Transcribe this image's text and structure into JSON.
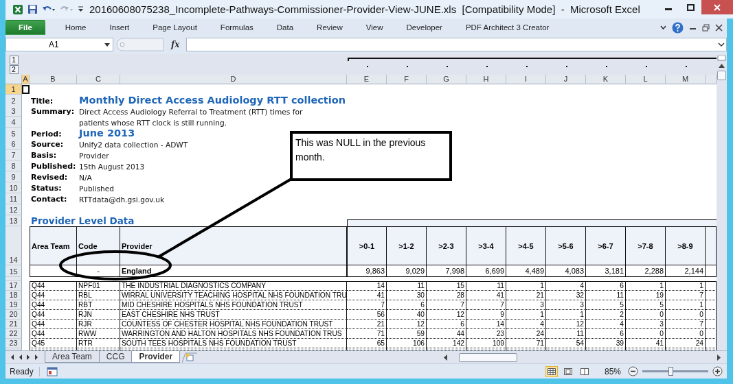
{
  "window": {
    "title": "20160608075238_Incomplete-Pathways-Commissioner-Provider-View-JUNE.xls  [Compatibility Mode]  -  Microsoft Excel"
  },
  "ribbon_tabs": [
    {
      "label": "File",
      "kind": "file",
      "selected": false
    },
    {
      "label": "Home",
      "kind": "tab",
      "selected": false
    },
    {
      "label": "Insert",
      "kind": "tab",
      "selected": false
    },
    {
      "label": "Page Layout",
      "kind": "tab",
      "selected": false
    },
    {
      "label": "Formulas",
      "kind": "tab",
      "selected": false
    },
    {
      "label": "Data",
      "kind": "tab",
      "selected": false
    },
    {
      "label": "Review",
      "kind": "tab",
      "selected": false
    },
    {
      "label": "View",
      "kind": "tab",
      "selected": false
    },
    {
      "label": "Developer",
      "kind": "tab",
      "selected": false
    },
    {
      "label": "PDF Architect 3 Creator",
      "kind": "tab",
      "selected": false
    }
  ],
  "formula_bar": {
    "name_box": "A1",
    "function_label": "fx"
  },
  "outline_levels": [
    "1",
    "2"
  ],
  "columns": [
    {
      "label": "A",
      "selected": true
    },
    {
      "label": "B",
      "selected": false
    },
    {
      "label": "C",
      "selected": false
    },
    {
      "label": "D",
      "selected": false
    },
    {
      "label": "E",
      "selected": false
    },
    {
      "label": "F",
      "selected": false
    },
    {
      "label": "G",
      "selected": false
    },
    {
      "label": "H",
      "selected": false
    },
    {
      "label": "I",
      "selected": false
    },
    {
      "label": "J",
      "selected": false
    },
    {
      "label": "K",
      "selected": false
    },
    {
      "label": "L",
      "selected": false
    },
    {
      "label": "M",
      "selected": false
    }
  ],
  "rows": [
    {
      "number": "1",
      "kind": "blank",
      "selected": true
    },
    {
      "number": "2",
      "kind": "info",
      "label": "Title:",
      "value": "Monthly Direct Access Audiology RTT collection",
      "emphasis": true,
      "selected": false
    },
    {
      "number": "3",
      "kind": "info",
      "label": "Summary:",
      "value": "Direct Access Audiology Referral to Treatment (RTT) times for",
      "emphasis": false,
      "selected": false
    },
    {
      "number": "4",
      "kind": "info",
      "value": "patients whose RTT clock is still running.",
      "emphasis": false,
      "selected": false
    },
    {
      "number": "5",
      "kind": "info",
      "label": "Period:",
      "value": "June 2013",
      "emphasis": true,
      "selected": false
    },
    {
      "number": "6",
      "kind": "info",
      "label": "Source:",
      "value": "Unify2 data collection - ADWT",
      "emphasis": false,
      "selected": false
    },
    {
      "number": "7",
      "kind": "info",
      "label": "Basis:",
      "value": "Provider",
      "emphasis": false,
      "selected": false
    },
    {
      "number": "8",
      "kind": "info",
      "label": "Published:",
      "value": "15th August 2013",
      "emphasis": false,
      "selected": false
    },
    {
      "number": "9",
      "kind": "info",
      "label": "Revised:",
      "value": "N/A",
      "emphasis": false,
      "selected": false
    },
    {
      "number": "10",
      "kind": "info",
      "label": "Status:",
      "value": "Published",
      "emphasis": false,
      "selected": false
    },
    {
      "number": "11",
      "kind": "info",
      "label": "Contact:",
      "value": "RTTdata@dh.gsi.gov.uk",
      "emphasis": false,
      "selected": false
    },
    {
      "number": "12",
      "kind": "blank",
      "selected": false
    },
    {
      "number": "13",
      "kind": "section",
      "label": "Provider Level Data",
      "selected": false
    },
    {
      "number": "14",
      "kind": "header",
      "cells": [
        "Area Team",
        "Code",
        "Provider",
        ">0-1",
        ">1-2",
        ">2-3",
        ">3-4",
        ">4-5",
        ">5-6",
        ">6-7",
        ">7-8",
        ">8-9"
      ],
      "selected": false
    },
    {
      "number": "15",
      "kind": "total",
      "code": "-",
      "provider": "England",
      "values": [
        "9,863",
        "9,029",
        "7,998",
        "6,699",
        "4,489",
        "4,083",
        "3,181",
        "2,288",
        "2,144"
      ],
      "selected": false
    },
    {
      "kind": "spacer"
    },
    {
      "number": "17",
      "kind": "data",
      "area_team": "Q44",
      "code": "NPF01",
      "provider": "THE INDUSTRIAL DIAGNOSTICS COMPANY",
      "values": [
        "14",
        "11",
        "15",
        "11",
        "1",
        "4",
        "6",
        "1",
        "1"
      ],
      "selected": false
    },
    {
      "number": "18",
      "kind": "data",
      "area_team": "Q44",
      "code": "RBL",
      "provider": "WIRRAL UNIVERSITY TEACHING HOSPITAL NHS FOUNDATION TRU",
      "values": [
        "41",
        "30",
        "28",
        "41",
        "21",
        "32",
        "11",
        "19",
        "7"
      ],
      "selected": false
    },
    {
      "number": "19",
      "kind": "data",
      "area_team": "Q44",
      "code": "RBT",
      "provider": "MID CHESHIRE HOSPITALS NHS FOUNDATION TRUST",
      "values": [
        "7",
        "6",
        "7",
        "7",
        "3",
        "3",
        "5",
        "5",
        "1"
      ],
      "selected": false
    },
    {
      "number": "20",
      "kind": "data",
      "area_team": "Q44",
      "code": "RJN",
      "provider": "EAST CHESHIRE NHS TRUST",
      "values": [
        "56",
        "40",
        "12",
        "9",
        "1",
        "1",
        "2",
        "0",
        "0"
      ],
      "selected": false
    },
    {
      "number": "21",
      "kind": "data",
      "area_team": "Q44",
      "code": "RJR",
      "provider": "COUNTESS OF CHESTER HOSPITAL NHS FOUNDATION TRUST",
      "values": [
        "21",
        "12",
        "6",
        "14",
        "4",
        "12",
        "4",
        "3",
        "7"
      ],
      "selected": false
    },
    {
      "number": "22",
      "kind": "data",
      "area_team": "Q44",
      "code": "RWW",
      "provider": "WARRINGTON AND HALTON HOSPITALS NHS FOUNDATION TRUS",
      "values": [
        "71",
        "59",
        "44",
        "23",
        "24",
        "11",
        "6",
        "0",
        "0"
      ],
      "selected": false
    },
    {
      "number": "23",
      "kind": "data",
      "area_team": "Q45",
      "code": "RTR",
      "provider": "SOUTH TEES HOSPITALS NHS FOUNDATION TRUST",
      "values": [
        "65",
        "106",
        "142",
        "109",
        "71",
        "54",
        "39",
        "41",
        "24"
      ],
      "selected": false
    },
    {
      "kind": "peek"
    }
  ],
  "callout": {
    "text": "This was NULL in the previous month."
  },
  "sheet_tabs": [
    {
      "label": "Area Team",
      "selected": false
    },
    {
      "label": "CCG",
      "selected": false
    },
    {
      "label": "Provider",
      "selected": true
    }
  ],
  "status_bar": {
    "status": "Ready",
    "zoom": "85%",
    "zoom_slider": {
      "level": 0.43
    }
  }
}
